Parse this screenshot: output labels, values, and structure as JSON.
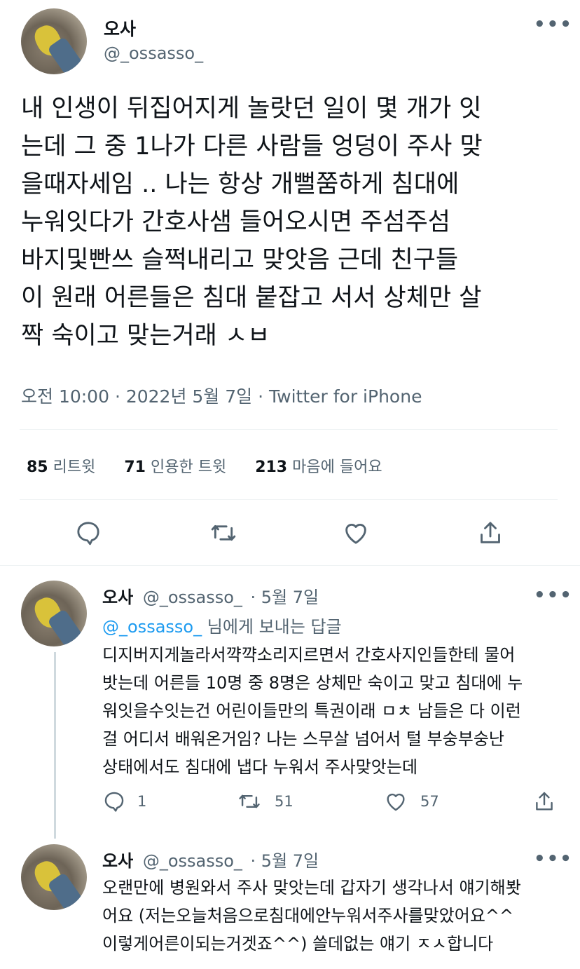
{
  "main": {
    "display_name": "오사",
    "handle": "@_ossasso_",
    "text_lines": [
      "내 인생이 뒤집어지게 놀랏던 일이 몇 개가 잇",
      "는데 그 중 1나가 다른 사람들 엉덩이 주사 맞",
      "을때자세임 .. 나는 항상 개뻘쭘하게 침대에",
      "누워잇다가 간호사샘 들어오시면 주섬주섬",
      "바지및빤쓰 슬쩍내리고 맞앗음 근데 친구들",
      "이 원래 어른들은 침대 붙잡고 서서 상체만 살",
      "짝 숙이고 맞는거래 ㅅㅂ"
    ],
    "meta": "오전 10:00 · 2022년 5월 7일 · Twitter for iPhone",
    "retweets_count": "85",
    "retweets_label": "리트윗",
    "quotes_count": "71",
    "quotes_label": "인용한 트윗",
    "likes_count": "213",
    "likes_label": "마음에 들어요"
  },
  "reply1": {
    "display_name": "오사",
    "handle": "@_ossasso_",
    "date": "· 5월 7일",
    "replying_handle": "@_ossasso_",
    "replying_suffix": "님에게 보내는 답글",
    "text_lines": [
      "디지버지게놀라서꺅꺅소리지르면서 간호사지인들한테 물어",
      "밧는데 어른들 10명 중 8명은 상체만 숙이고 맞고 침대에 누",
      "워잇을수잇는건 어린이들만의 특권이래 ㅁㅊ 남들은 다 이런",
      "걸 어디서 배워온거임? 나는 스무살 넘어서 털 부숭부숭난",
      "상태에서도 침대에 냅다 누워서 주사맞앗는데"
    ],
    "reply_count": "1",
    "retweet_count": "51",
    "like_count": "57"
  },
  "reply2": {
    "display_name": "오사",
    "handle": "@_ossasso_",
    "date": "· 5월 7일",
    "text_lines": [
      "오랜만에 병원와서 주사 맞앗는데 갑자기 생각나서 얘기해봣",
      "어요 (저는오늘처음으로침대에안누워서주사를맞았어요^^",
      "이렇게어른이되는거겟죠^^) 쓸데없는 얘기 ㅈㅅ합니다"
    ]
  },
  "icons": {
    "more": "more-horizontal-icon",
    "reply": "reply-bubble-icon",
    "retweet": "retweet-icon",
    "like": "heart-icon",
    "share": "share-icon"
  },
  "colors": {
    "text": "#0f1419",
    "secondary": "#536471",
    "link": "#1d9bf0",
    "divider": "#eff3f4"
  }
}
